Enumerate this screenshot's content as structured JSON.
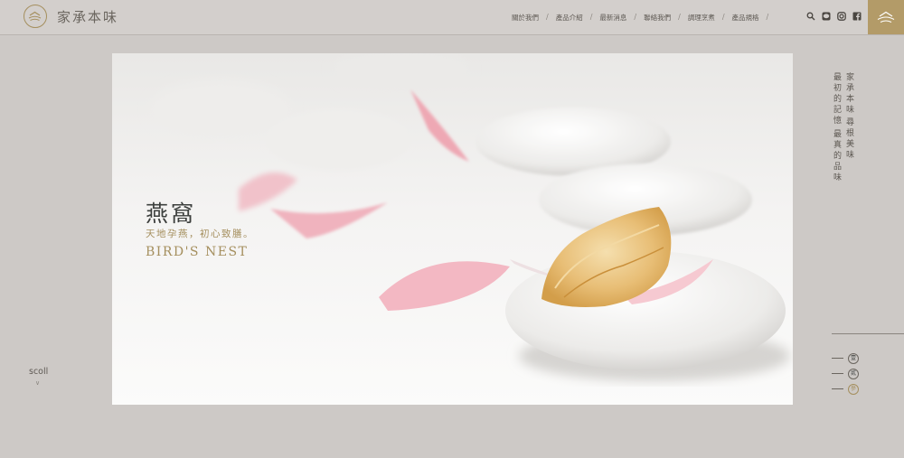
{
  "brand": {
    "name": "家承本味"
  },
  "nav": {
    "items": [
      "關於我們",
      "產品介紹",
      "最新消息",
      "聯絡我們",
      "調理烹煮",
      "產品規格"
    ]
  },
  "icons": [
    "search-icon",
    "line-icon",
    "instagram-icon",
    "facebook-icon",
    "menu-icon"
  ],
  "hero": {
    "title": "燕窩",
    "subtitle": "天地孕燕，初心致膳。",
    "english": "BIRD'S NEST"
  },
  "side": {
    "line1": "家承本味",
    "line2": "尋根美味",
    "line3": "最初的記憶",
    "line4": "最真的品味"
  },
  "scroll": {
    "label": "scoll",
    "arrow": "∨"
  },
  "pager": {
    "items": [
      "壹",
      "貳",
      "參"
    ],
    "active_index": 2
  },
  "colors": {
    "accent": "#a58f5e",
    "gold_button": "#b39b68",
    "background": "#cdc9c6",
    "text": "#3c3f3d"
  }
}
